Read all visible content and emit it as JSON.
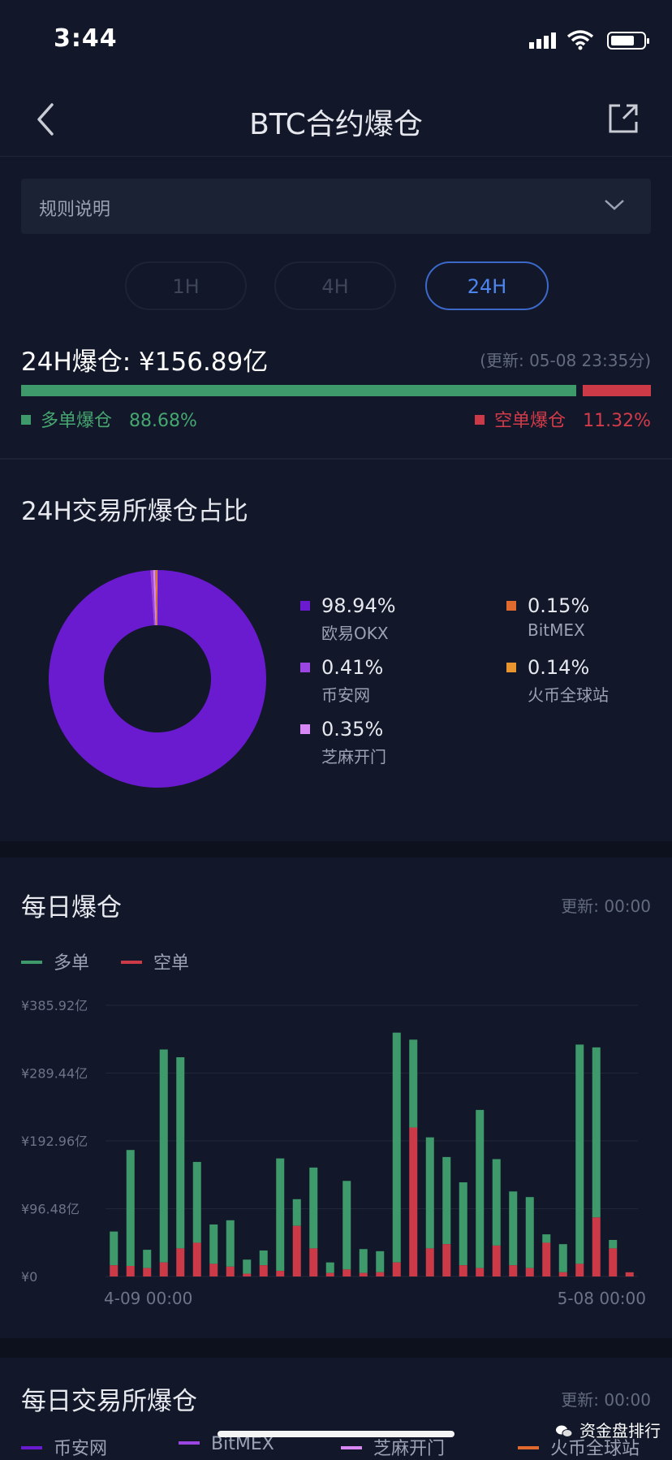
{
  "status": {
    "time": "3:44"
  },
  "nav": {
    "title": "BTC合约爆仓"
  },
  "rules": {
    "label": "规则说明"
  },
  "tabs": [
    {
      "label": "1H",
      "active": false
    },
    {
      "label": "4H",
      "active": false
    },
    {
      "label": "24H",
      "active": true
    }
  ],
  "summary": {
    "total": "24H爆仓: ¥156.89亿",
    "updated": "(更新: 05-08 23:35分)",
    "long_label": "多单爆仓",
    "long_pct": "88.68%",
    "short_label": "空单爆仓",
    "short_pct": "11.32%",
    "long_ratio": 0.8868,
    "short_ratio": 0.1132,
    "colors": {
      "long": "#3e9a6b",
      "short": "#cd3a47"
    }
  },
  "exchange_share": {
    "title": "24H交易所爆仓占比",
    "items": [
      {
        "pct": "98.94%",
        "name": "欧易OKX",
        "color": "#6a1bd0",
        "value": 98.94
      },
      {
        "pct": "0.41%",
        "name": "币安网",
        "color": "#9b46e0",
        "value": 0.41
      },
      {
        "pct": "0.35%",
        "name": "芝麻开门",
        "color": "#d888f5",
        "value": 0.35
      },
      {
        "pct": "0.15%",
        "name": "BitMEX",
        "color": "#e0692d",
        "value": 0.15
      },
      {
        "pct": "0.14%",
        "name": "火币全球站",
        "color": "#e8952f",
        "value": 0.14
      }
    ]
  },
  "daily": {
    "title": "每日爆仓",
    "updated": "更新: 00:00",
    "legend": [
      {
        "label": "多单",
        "color": "#3e9a6b"
      },
      {
        "label": "空单",
        "color": "#cd3a47"
      }
    ]
  },
  "chart_data": {
    "type": "bar",
    "stacked": true,
    "y_tick_labels": [
      "¥385.92亿",
      "¥289.44亿",
      "¥192.96亿",
      "¥96.48亿",
      "¥0"
    ],
    "ylim": [
      0,
      385.92
    ],
    "x_tick_labels": [
      "4-09 00:00",
      "5-08 00:00"
    ],
    "grid": true,
    "series": [
      {
        "name": "空单",
        "color": "#cd3a47",
        "values": [
          16,
          15,
          12,
          20,
          40,
          48,
          18,
          14,
          4,
          16,
          8,
          72,
          40,
          5,
          10,
          5,
          6,
          20,
          212,
          40,
          46,
          16,
          12,
          44,
          16,
          12,
          48,
          6,
          18,
          84,
          40,
          6
        ]
      },
      {
        "name": "多单",
        "color": "#3e9a6b",
        "values": [
          48,
          165,
          26,
          303,
          272,
          115,
          56,
          66,
          20,
          21,
          160,
          38,
          115,
          15,
          126,
          34,
          30,
          327,
          125,
          158,
          124,
          118,
          225,
          123,
          105,
          101,
          12,
          40,
          312,
          242,
          12,
          0
        ]
      }
    ]
  },
  "daily_exchange": {
    "title": "每日交易所爆仓",
    "updated": "更新: 00:00",
    "legend": [
      {
        "label": "币安网",
        "color": "#6a1bd0"
      },
      {
        "label": "BitMEX",
        "color": "#9b46e0"
      },
      {
        "label": "芝麻开门",
        "color": "#d888f5"
      },
      {
        "label": "火币全球站",
        "color": "#e0692d"
      }
    ]
  },
  "watermark": {
    "text": "资金盘排行"
  }
}
